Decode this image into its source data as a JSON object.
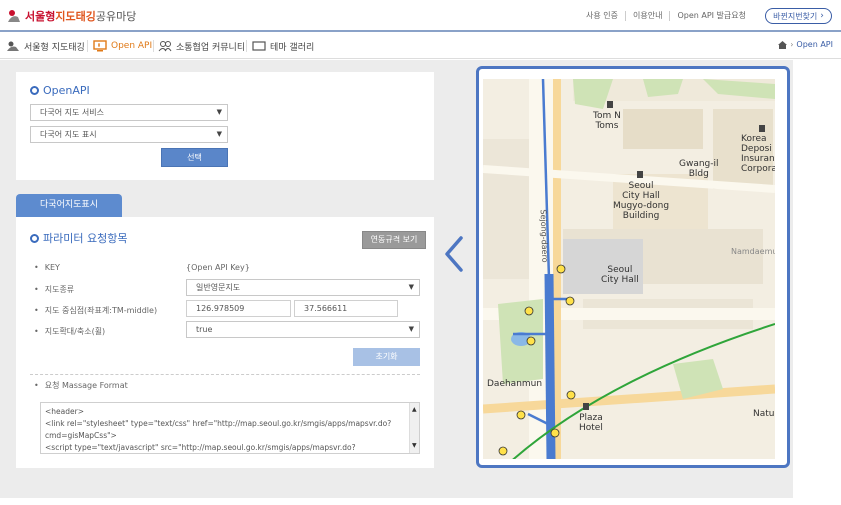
{
  "header": {
    "logo": {
      "part1": "서울형 ",
      "part2": "지도태깅",
      "part3": " 공유마당"
    },
    "links": [
      "사용 인증",
      "이용안내",
      "Open API 발급요청"
    ],
    "button": "바뀐지번찾기"
  },
  "nav": {
    "items": [
      {
        "label": "서울형 지도태깅",
        "icon": "tagging-icon"
      },
      {
        "label": "Open API",
        "icon": "monitor-icon"
      },
      {
        "label": "소통협업 커뮤니티",
        "icon": "people-icon"
      },
      {
        "label": "테마 갤러리",
        "icon": "gallery-icon"
      }
    ],
    "active_index": 1,
    "breadcrumb": "Open API"
  },
  "openapi": {
    "title": "OpenAPI",
    "select1": "다국어 지도 서비스",
    "select2": "다국어 지도 표시",
    "submit": "선택"
  },
  "tab": {
    "label": "다국어지도표시"
  },
  "params": {
    "title": "파라미터 요청항목",
    "spec_button": "연동규격 보기",
    "rows": [
      {
        "label": "KEY",
        "value": "{Open API Key}"
      },
      {
        "label": "지도종류",
        "value": "일반영문지도"
      },
      {
        "label": "지도 중심점(좌표계:TM-middle)",
        "value_x": "126.978509",
        "value_y": "37.566611"
      },
      {
        "label": "지도확대/축소(휠)",
        "value": "true"
      }
    ],
    "reset": "초기화",
    "format_label": "요청 Massage Format",
    "code_lines": [
      "<header>",
      "<link rel=\"stylesheet\" type=\"text/css\" href=\"http://map.seoul.go.kr/smgis/apps/mapsvr.do?",
      "cmd=gisMapCss\">",
      "<script type=\"text/javascript\" src=\"http://map.seoul.go.kr/smgis/apps/mapsvr.do?"
    ]
  },
  "map": {
    "labels": {
      "tom": "Tom N\nToms",
      "korea": "Korea\nDeposi\nInsuranc\nCorporatio",
      "gwangil": "Gwang-il\nBldg",
      "cityhall_mugyo": "Seoul\nCity Hall\nMugyo-dong\nBuilding",
      "sejong": "Sejong-daero",
      "namdaemun": "Namdaemun",
      "seoul_cityhall": "Seoul\nCity Hall",
      "daehanmun": "Daehanmun",
      "plaza": "Plaza\nHotel",
      "natu": "Natu"
    },
    "markers": [
      "4",
      "5",
      "3",
      "2",
      "6",
      "1",
      "7",
      "c"
    ]
  },
  "colors": {
    "accent": "#3a6bbd",
    "nav_active": "#e07a18",
    "tab": "#5d8bcf",
    "frame": "#4d76c2",
    "road_blue": "#4a7bd0",
    "road_green": "#2fa53a"
  }
}
